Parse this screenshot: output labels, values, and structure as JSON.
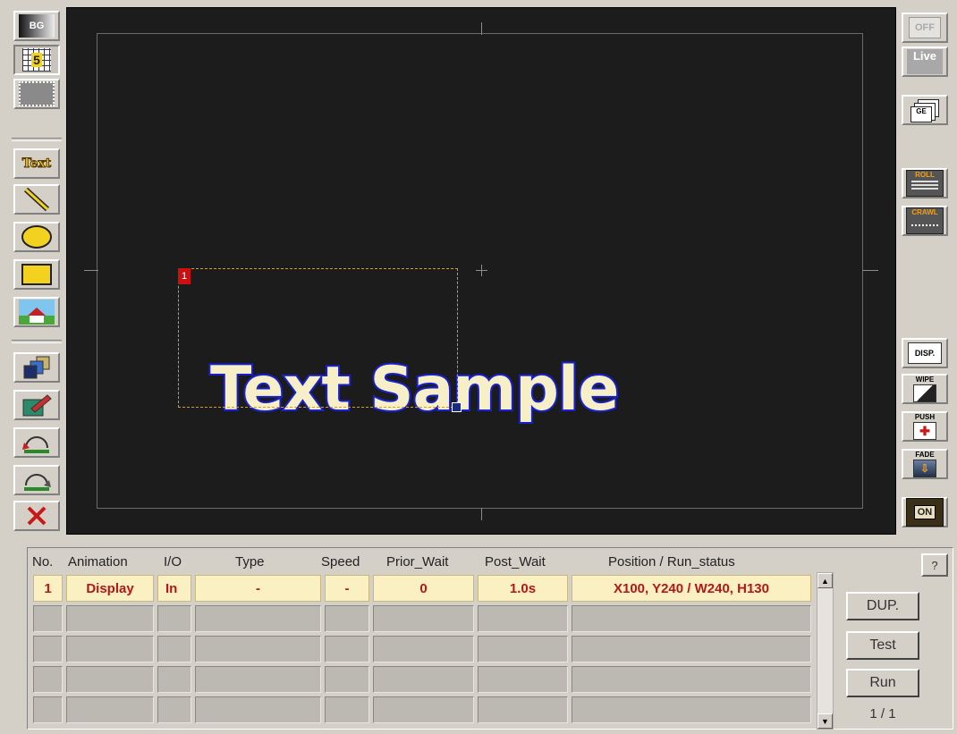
{
  "left_toolbar": {
    "bg_label": "BG",
    "grid_label": "5",
    "text_label": "Text"
  },
  "right_toolbar": {
    "off_label": "OFF",
    "live_label": "Live",
    "ge_label": "GE",
    "roll_label": "ROLL",
    "crawl_label": "CRAWL",
    "disp_label": "DISP.",
    "wipe_label": "WIPE",
    "push_label": "PUSH",
    "fade_label": "FADE",
    "on_label": "ON"
  },
  "canvas": {
    "sample_text": "Text Sample",
    "selection_number": "1"
  },
  "table": {
    "headers": [
      "No.",
      "Animation",
      "I/O",
      "Type",
      "Speed",
      "Prior_Wait",
      "Post_Wait",
      "Position / Run_status"
    ],
    "rows": [
      {
        "no": "1",
        "animation": "Display",
        "io": "In",
        "type": "-",
        "speed": "-",
        "prior_wait": "0",
        "post_wait": "1.0s",
        "position": "X100, Y240 / W240, H130"
      }
    ]
  },
  "buttons": {
    "help_label": "?",
    "dup_label": "DUP.",
    "test_label": "Test",
    "run_label": "Run"
  },
  "page_indicator": "1 / 1"
}
